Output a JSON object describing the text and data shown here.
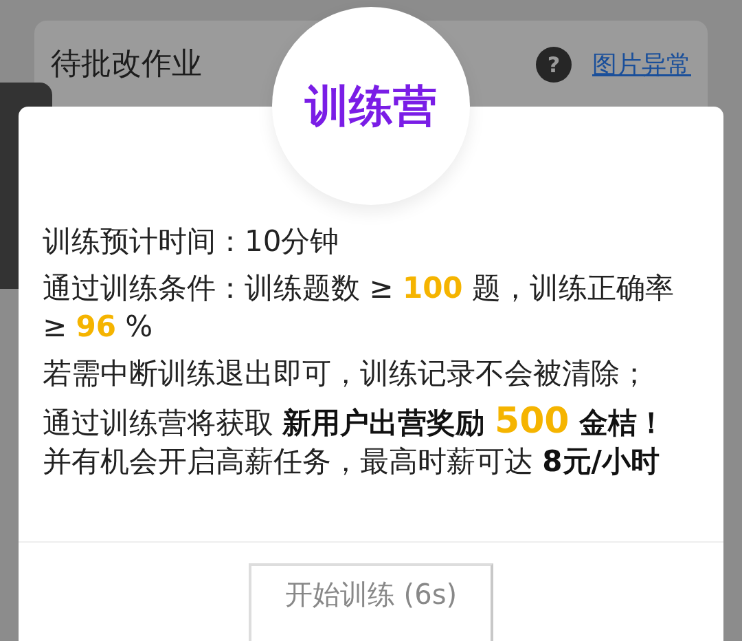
{
  "background_card": {
    "title": "待批改作业",
    "help": "?",
    "link": "图片异常"
  },
  "modal": {
    "title": "训练营",
    "paragraphs": [
      {
        "lines": [
          [
            {
              "kind": "text",
              "text": "训练预计时间：10分钟"
            }
          ]
        ]
      },
      {
        "lines": [
          [
            {
              "kind": "text",
              "text": "通过训练条件：训练题数 ≥ "
            },
            {
              "kind": "highlight",
              "text": "100"
            },
            {
              "kind": "text",
              "text": " 题，训练正确率 ≥ "
            },
            {
              "kind": "highlight",
              "text": "96"
            },
            {
              "kind": "text",
              "text": " %"
            }
          ]
        ]
      },
      {
        "lines": [
          [
            {
              "kind": "text",
              "text": "若需中断训练退出即可，训练记录不会被清除；"
            }
          ]
        ]
      },
      {
        "lines": [
          [
            {
              "kind": "text",
              "text": "通过训练营将获取 "
            },
            {
              "kind": "bold",
              "text": "新用户出营奖励 "
            },
            {
              "kind": "big",
              "text": "500"
            },
            {
              "kind": "bold",
              "text": " 金桔！"
            }
          ],
          [
            {
              "kind": "text",
              "text": "并有机会开启高薪任务，最高时薪可达 "
            },
            {
              "kind": "bold",
              "text": "8元/小时"
            }
          ]
        ]
      }
    ],
    "button": {
      "label": "开始训练 (6s)",
      "disabled": true
    }
  }
}
